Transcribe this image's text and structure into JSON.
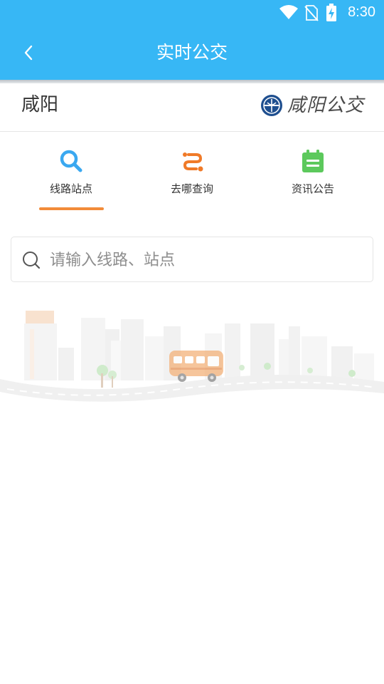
{
  "status_bar": {
    "time": "8:30",
    "icons": [
      "wifi-icon",
      "no-sim-icon",
      "battery-charging-icon"
    ]
  },
  "app_bar": {
    "back_icon": "chevron-left-icon",
    "title": "实时公交"
  },
  "city_header": {
    "city": "咸阳",
    "brand_name": "咸阳公交",
    "brand_logo": "bus-company-logo"
  },
  "tabs": [
    {
      "label": "线路站点",
      "icon": "search-icon",
      "color": "#3aa8f0",
      "selected": true
    },
    {
      "label": "去哪查询",
      "icon": "route-icon",
      "color": "#f07a28",
      "selected": false
    },
    {
      "label": "资讯公告",
      "icon": "notice-icon",
      "color": "#5cc95c",
      "selected": false
    }
  ],
  "search": {
    "placeholder": "请输入线路、站点",
    "value": ""
  },
  "colors": {
    "primary": "#37b7f5",
    "tab_indicator": "#f28b39"
  },
  "illustration": "city-bus-illustration"
}
